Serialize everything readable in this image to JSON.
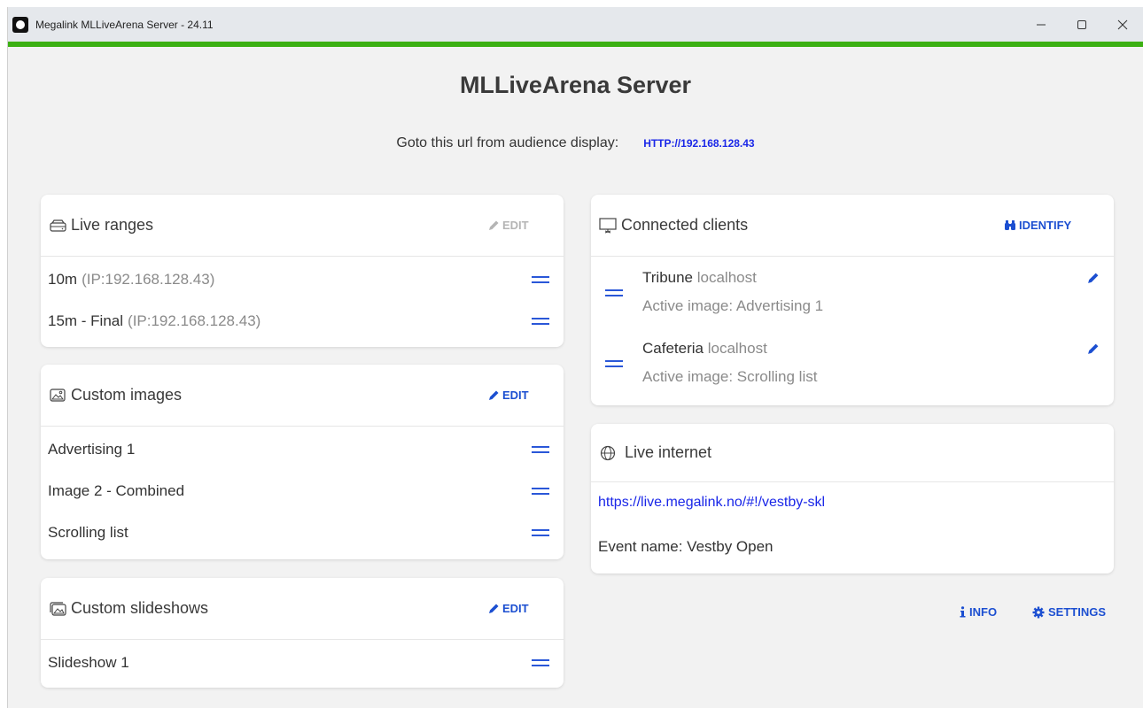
{
  "window": {
    "title": "Megalink MLLiveArena Server - 24.11",
    "controls": [
      "minimize-icon",
      "maximize-icon",
      "close-icon"
    ]
  },
  "header": {
    "title": "MLLiveArena Server",
    "url_label": "Goto this url from audience display:",
    "url": "HTTP://192.168.128.43"
  },
  "live_ranges": {
    "title": "Live ranges",
    "icon": "drive-icon",
    "edit_label": "EDIT",
    "items": [
      {
        "name": "10m",
        "ip": "(IP:192.168.128.43)"
      },
      {
        "name": "15m - Final",
        "ip": "(IP:192.168.128.43)"
      }
    ]
  },
  "custom_images": {
    "title": "Custom images",
    "icon": "image-icon",
    "edit_label": "EDIT",
    "items": [
      "Advertising 1",
      "Image 2 - Combined",
      "Scrolling list"
    ]
  },
  "custom_slideshows": {
    "title": "Custom slideshows",
    "icon": "images-icon",
    "edit_label": "EDIT",
    "items": [
      "Slideshow 1"
    ]
  },
  "connected_clients": {
    "title": "Connected clients",
    "icon": "presentation-icon",
    "identify_label": "IDENTIFY",
    "clients": [
      {
        "name": "Tribune",
        "host": "localhost",
        "active": "Active image: Advertising 1"
      },
      {
        "name": "Cafeteria",
        "host": "localhost",
        "active": "Active image: Scrolling list"
      }
    ]
  },
  "live_internet": {
    "title": "Live internet",
    "icon": "globe-icon",
    "link": "https://live.megalink.no/#!/vestby-skl",
    "event": "Event name: Vestby Open"
  },
  "footer": {
    "info_label": "INFO",
    "settings_label": "SETTINGS"
  },
  "colors": {
    "accent_green": "#3cb013",
    "link_blue": "#1a27e8",
    "button_blue": "#1c4fd1",
    "disabled_grey": "#b5b5b5"
  }
}
